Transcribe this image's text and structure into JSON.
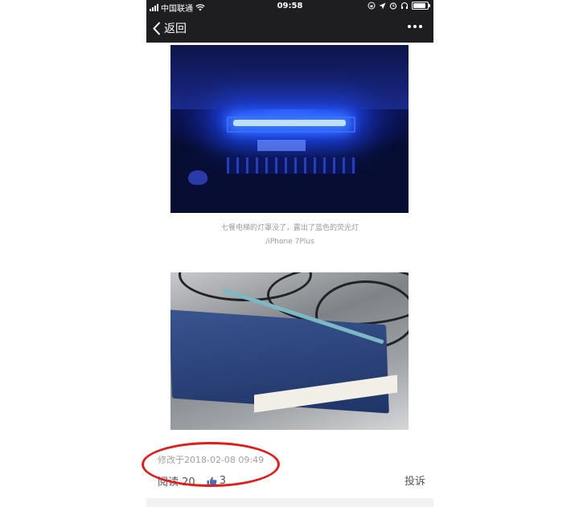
{
  "statusbar": {
    "carrier": "中国联通",
    "time": "09:58"
  },
  "nav": {
    "back_label": "返回"
  },
  "article": {
    "caption_line1": "七餐电梯的灯罩没了，露出了蓝色的荧光灯",
    "caption_line2": "/iPhone 7Plus",
    "modified": "修改于2018-02-08 09:49",
    "reads": "阅读 20",
    "likes": "3",
    "report_label": "投诉"
  },
  "colors": {
    "bar": "#1e1e20",
    "highlight": "#e51b1b"
  }
}
